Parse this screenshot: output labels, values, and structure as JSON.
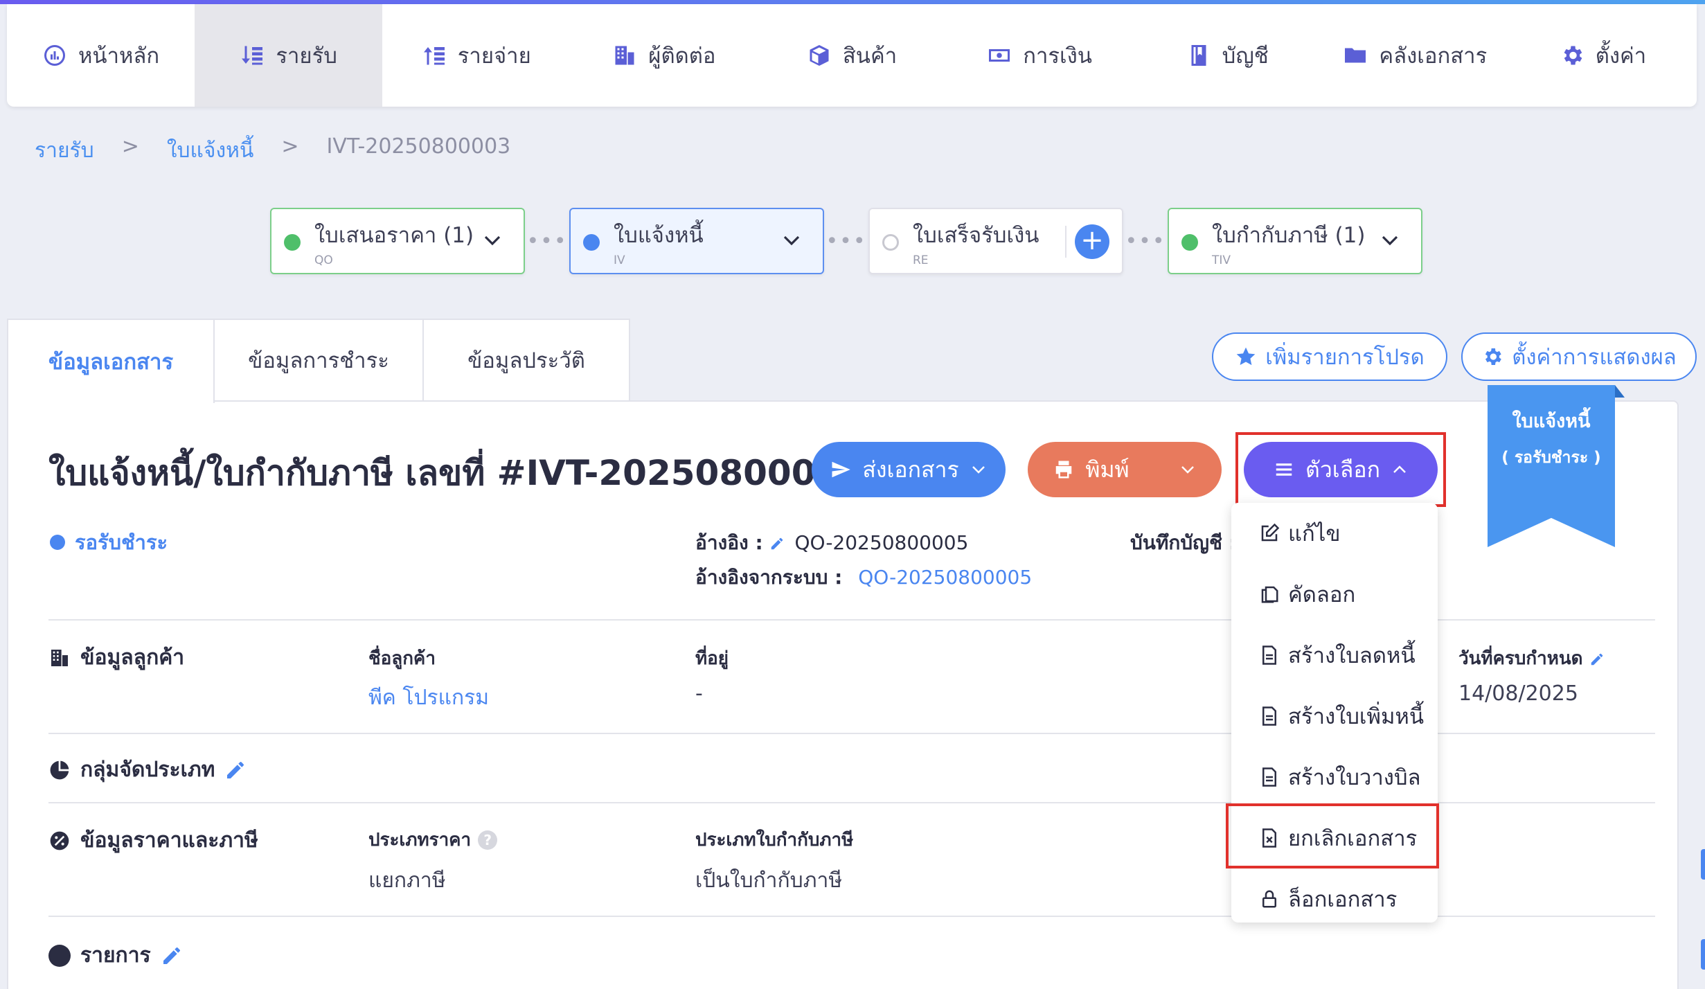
{
  "nav": {
    "items": [
      {
        "label": "หน้าหลัก",
        "icon": "dashboard-icon"
      },
      {
        "label": "รายรับ",
        "icon": "income-icon"
      },
      {
        "label": "รายจ่าย",
        "icon": "expense-icon"
      },
      {
        "label": "ผู้ติดต่อ",
        "icon": "contacts-icon"
      },
      {
        "label": "สินค้า",
        "icon": "box-icon"
      },
      {
        "label": "การเงิน",
        "icon": "money-icon"
      },
      {
        "label": "บัญชี",
        "icon": "book-icon"
      },
      {
        "label": "คลังเอกสาร",
        "icon": "folder-icon"
      },
      {
        "label": "ตั้งค่า",
        "icon": "gear-icon"
      }
    ],
    "active_index": 1
  },
  "breadcrumb": {
    "level1": "รายรับ",
    "sep": ">",
    "level2": "ใบแจ้งหนี้",
    "level3": "IVT-20250800003"
  },
  "flow": {
    "qo": {
      "label": "ใบเสนอราคา (1)",
      "code": "QO"
    },
    "iv": {
      "label": "ใบแจ้งหนี้",
      "code": "IV"
    },
    "re": {
      "label": "ใบเสร็จรับเงิน",
      "code": "RE",
      "add": "+"
    },
    "tiv": {
      "label": "ใบกำกับภาษี (1)",
      "code": "TIV"
    },
    "dots": "•••"
  },
  "tabs": {
    "doc_info": "ข้อมูลเอกสาร",
    "payment_info": "ข้อมูลการชำระ",
    "history_info": "ข้อมูลประวัติ"
  },
  "actions": {
    "favorite": "เพิ่มรายการโปรด",
    "display_settings": "ตั้งค่าการแสดงผล"
  },
  "document": {
    "title": "ใบแจ้งหนี้/ใบกำกับภาษี เลขที่ #IVT-20250800003",
    "status": "รอรับชำระ"
  },
  "buttons": {
    "send": "ส่งเอกสาร",
    "print": "พิมพ์",
    "options": "ตัวเลือก"
  },
  "ribbon": {
    "line1": "ใบแจ้งหนี้",
    "line2": "( รอรับชำระ )"
  },
  "reference": {
    "ref_label": "อ้างอิง :",
    "ref_value": "QO-20250800005",
    "sys_ref_label": "อ้างอิงจากระบบ :",
    "sys_ref_value": "QO-20250800005",
    "ledger_label": "บันทึกบัญชี :"
  },
  "customer": {
    "section": "ข้อมูลลูกค้า",
    "name_label": "ชื่อลูกค้า",
    "name_value": "พีค โปรแกรม",
    "address_label": "ที่อยู่",
    "address_value": "-",
    "due_label": "วันที่ครบกำหนด",
    "due_value": "14/08/2025"
  },
  "group": {
    "section": "กลุ่มจัดประเภท"
  },
  "pricing": {
    "section": "ข้อมูลราคาและภาษี",
    "price_type_label": "ประเภทราคา",
    "price_type_value": "แยกภาษี",
    "tax_type_label": "ประเภทใบกำกับภาษี",
    "tax_type_value": "เป็นใบกำกับภาษี",
    "help": "?"
  },
  "items": {
    "section": "รายการ"
  },
  "menu": {
    "edit": "แก้ไข",
    "copy": "คัดลอก",
    "credit_note": "สร้างใบลดหนี้",
    "debit_note": "สร้างใบเพิ่มหนี้",
    "billing_note": "สร้างใบวางบิล",
    "cancel": "ยกเลิกเอกสาร",
    "lock": "ล็อกเอกสาร"
  },
  "colors": {
    "primary": "#4a86f0",
    "options": "#6a5cf0",
    "print": "#e87a5d",
    "highlight": "#e1312c",
    "done": "#4fbf6a"
  }
}
